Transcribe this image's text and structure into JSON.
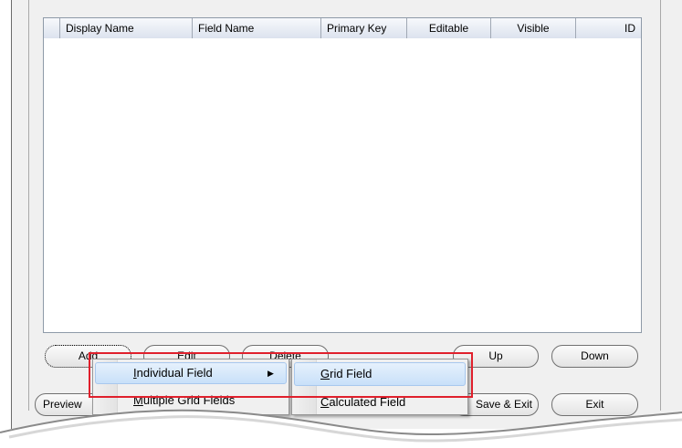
{
  "grid": {
    "columns": [
      "",
      "Display Name",
      "Field Name",
      "Primary Key",
      "Editable",
      "Visible",
      "ID"
    ]
  },
  "buttons": {
    "add": "Add",
    "edit": "Edit",
    "delete": "Delete",
    "up": "Up",
    "down": "Down",
    "preview": "Preview",
    "save_exit": "Save & Exit",
    "exit": "Exit"
  },
  "menu": {
    "items": [
      {
        "label_access": "I",
        "label_rest": "ndividual Field",
        "has_submenu": true,
        "highlighted": true
      },
      {
        "label_access": "M",
        "label_rest": "ultiple Grid Fields",
        "has_submenu": false,
        "highlighted": false
      }
    ],
    "submenu_arrow": "▶"
  },
  "submenu": {
    "items": [
      {
        "label_access": "G",
        "label_rest": "rid Field",
        "highlighted": true
      },
      {
        "label_access": "C",
        "label_rest": "alculated Field",
        "highlighted": false
      }
    ]
  },
  "colors": {
    "callout": "#e0202c",
    "highlight": "#c8e0f9"
  }
}
